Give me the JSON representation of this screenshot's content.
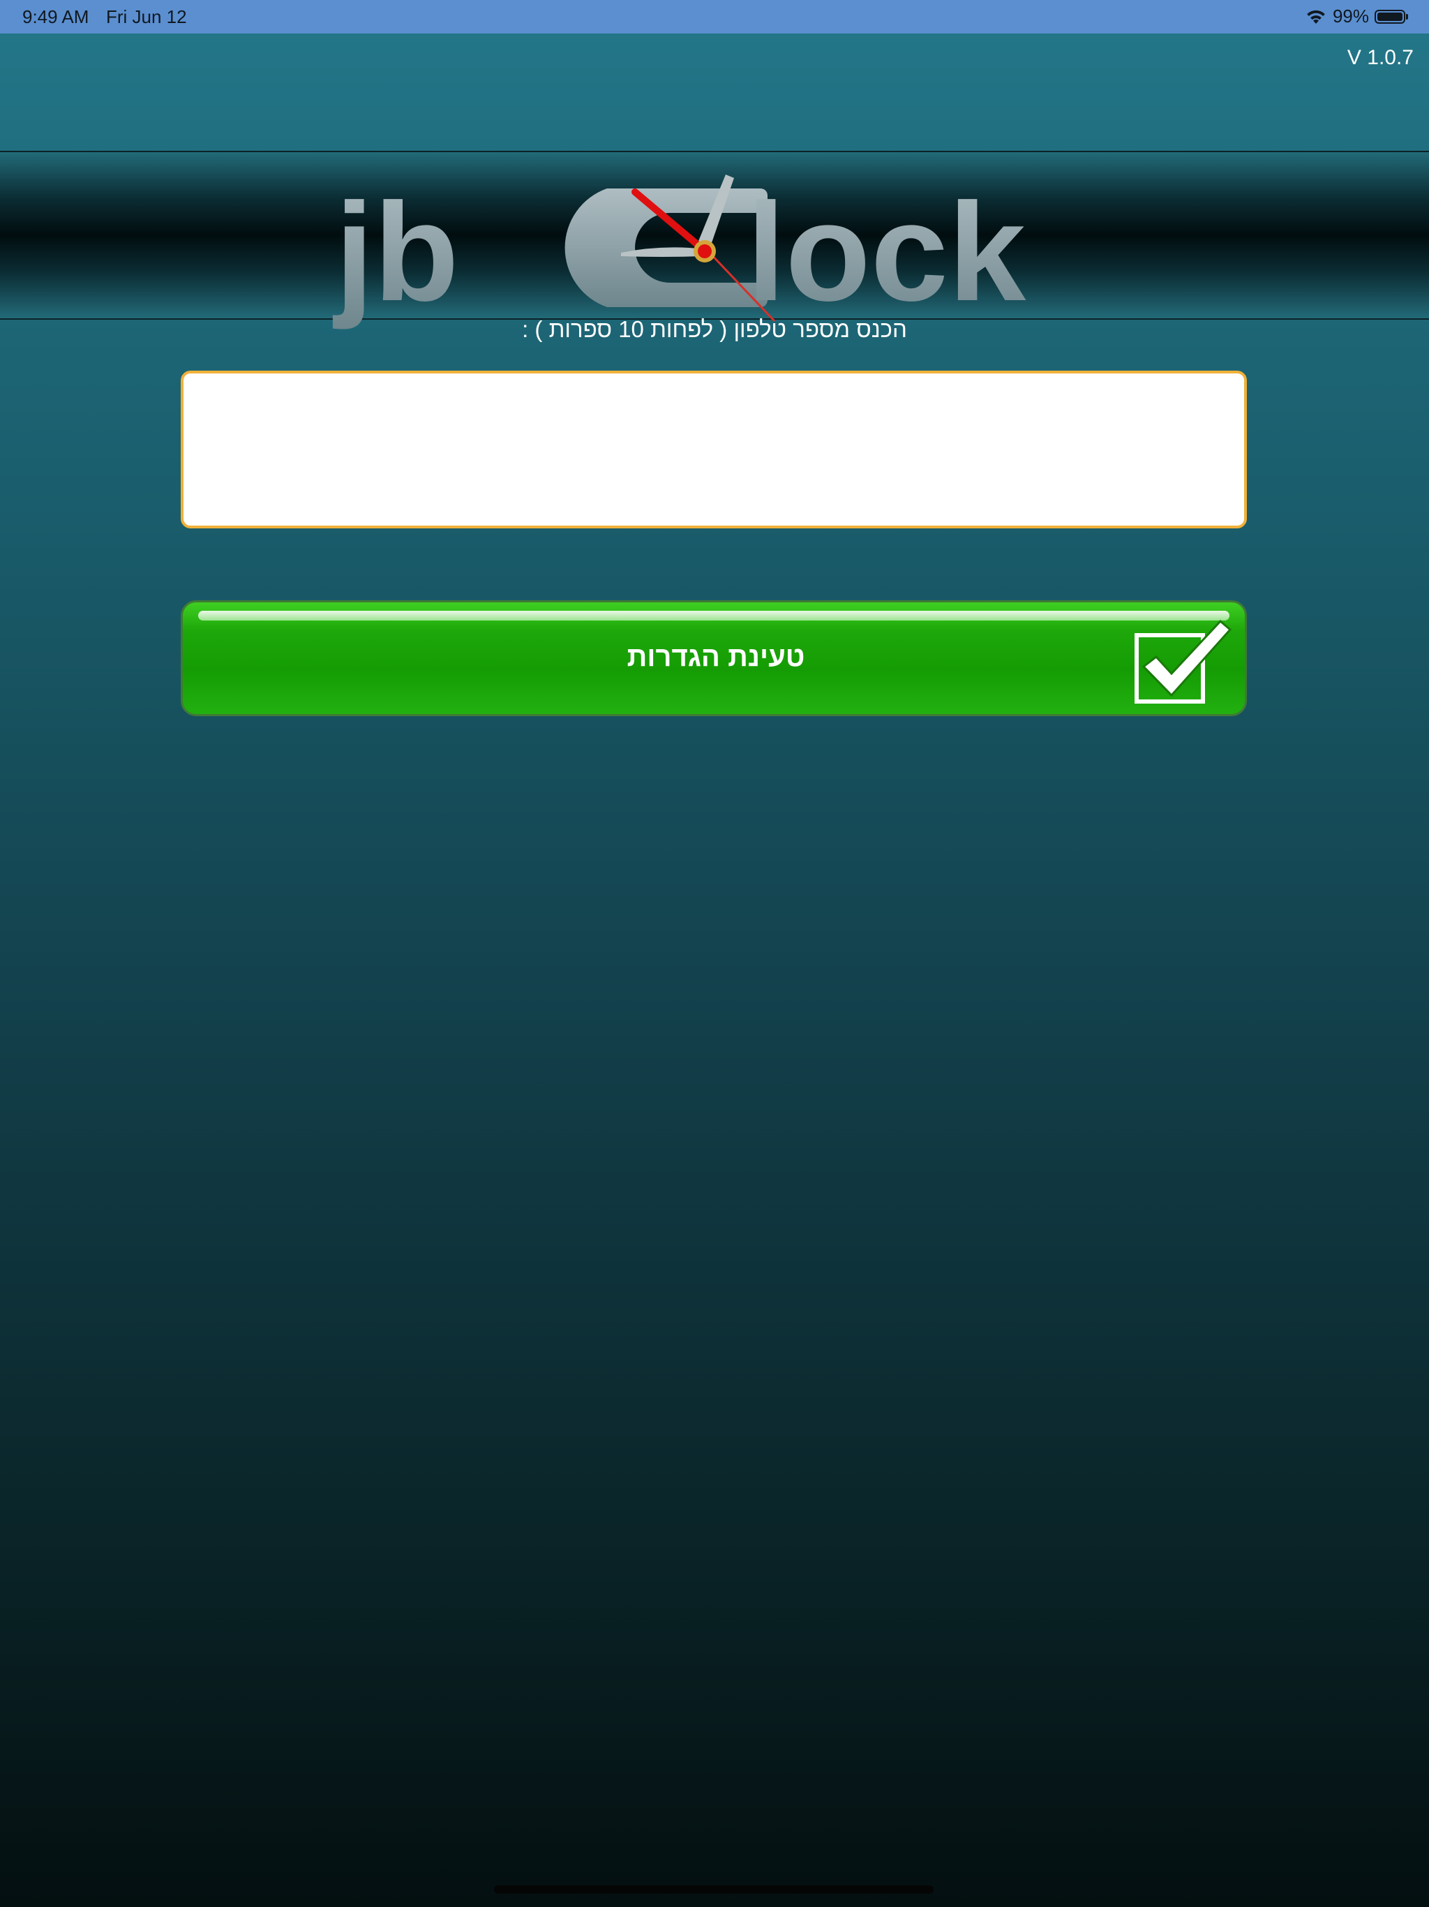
{
  "status_bar": {
    "time": "9:49 AM",
    "date": "Fri Jun 12",
    "battery": "99%",
    "battery_level": 0.99
  },
  "version": "V 1.0.7",
  "logo": {
    "left": "jb",
    "right": "lock",
    "icon": "clock-logo"
  },
  "phone": {
    "prompt": "הכנס מספר טלפון ( לפחות 10 ספרות ) :",
    "value": "",
    "placeholder": ""
  },
  "load_button": {
    "label": "טעינת הגדרות",
    "icon": "checkbox-check-icon"
  },
  "colors": {
    "status_bar": "#5b8fd0",
    "input_border": "#f0b13a",
    "button_green": "#1ea80a",
    "clock_hand_red": "#e01010",
    "logo_gray": "#8aa1a8"
  }
}
